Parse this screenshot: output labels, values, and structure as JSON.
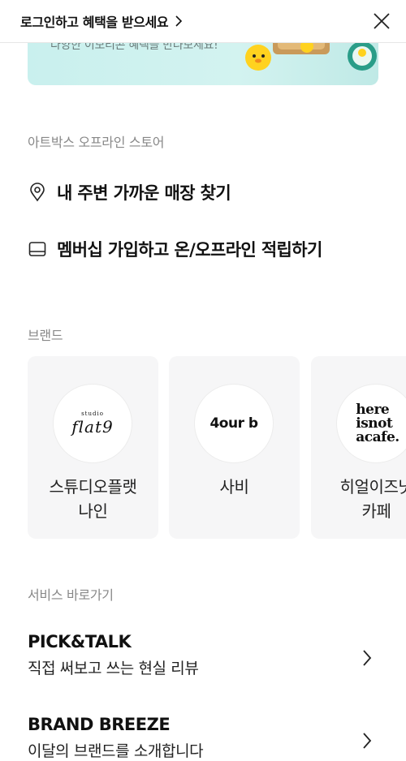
{
  "header": {
    "login_label": "로그인하고 혜택을 받으세요",
    "icons": {
      "login_chevron": "chevron-right-icon",
      "close": "close-icon"
    }
  },
  "banner": {
    "text": "다양한 이모티콘 혜택을 만나보세요!"
  },
  "offline_store": {
    "section_title": "아트박스 오프라인 스토어",
    "items": [
      {
        "label": "내 주변 가까운 매장 찾기",
        "icon": "location-pin-icon"
      },
      {
        "label": "멤버십 가입하고 온/오프라인 적립하기",
        "icon": "membership-card-icon"
      }
    ]
  },
  "brands": {
    "section_title": "브랜드",
    "items": [
      {
        "name": "스튜디오플랫\n나인",
        "logo_small": "studio",
        "logo_text": "flat9"
      },
      {
        "name": "사비",
        "logo_text": "4our b"
      },
      {
        "name": "히얼이즈낫\n카페",
        "logo_lines": [
          "here",
          "isnot",
          "acafe."
        ]
      }
    ]
  },
  "services": {
    "section_title": "서비스 바로가기",
    "items": [
      {
        "title": "PICK&TALK",
        "subtitle": "직접 써보고 쓰는 현실 리뷰"
      },
      {
        "title": "BRAND BREEZE",
        "subtitle": "이달의 브랜드를 소개합니다"
      }
    ]
  },
  "colors": {
    "banner_bg": "#cdf1ee",
    "card_bg": "#f6f6f7",
    "section_gray": "#888888",
    "divider": "#e6e6e6"
  }
}
